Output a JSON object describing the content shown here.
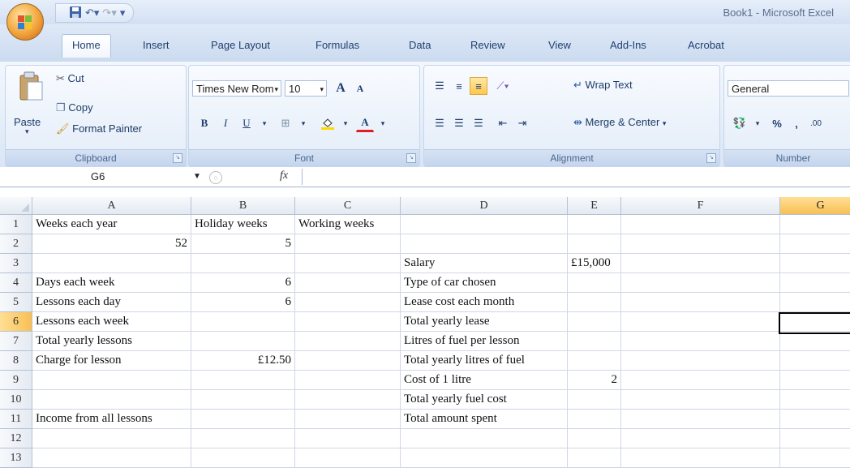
{
  "window": {
    "title": "Book1 - Microsoft Excel"
  },
  "qat": {
    "save_icon": "save-icon",
    "undo_icon": "undo-icon",
    "redo_icon": "redo-icon",
    "customize": "customize-arrow"
  },
  "tabs": [
    {
      "label": "Home",
      "active": true
    },
    {
      "label": "Insert"
    },
    {
      "label": "Page Layout"
    },
    {
      "label": "Formulas"
    },
    {
      "label": "Data"
    },
    {
      "label": "Review"
    },
    {
      "label": "View"
    },
    {
      "label": "Add-Ins"
    },
    {
      "label": "Acrobat"
    }
  ],
  "ribbon": {
    "clipboard": {
      "label": "Clipboard",
      "paste": "Paste",
      "cut": "Cut",
      "copy": "Copy",
      "format_painter": "Format Painter"
    },
    "font": {
      "label": "Font",
      "font_name": "Times New Rom",
      "font_size": "10",
      "bold": "B",
      "italic": "I",
      "underline": "U",
      "grow": "A",
      "shrink": "A",
      "font_color": "A"
    },
    "alignment": {
      "label": "Alignment",
      "wrap_text": "Wrap Text",
      "merge_center": "Merge & Center"
    },
    "number": {
      "label": "Number",
      "format": "General",
      "percent": "%",
      "comma": ","
    }
  },
  "formula_bar": {
    "name_box": "G6",
    "fx": "fx",
    "formula": ""
  },
  "columns": [
    "A",
    "B",
    "C",
    "D",
    "E",
    "F",
    "G"
  ],
  "selected_column": "G",
  "selected_row": "6",
  "rows": [
    {
      "num": "1",
      "A": "Weeks each year",
      "B": "Holiday weeks",
      "C": "Working weeks",
      "D": "",
      "E": ""
    },
    {
      "num": "2",
      "A": "52",
      "B": "5",
      "C": "",
      "D": "",
      "E": ""
    },
    {
      "num": "3",
      "A": "",
      "B": "",
      "C": "",
      "D": "Salary",
      "E": "£15,000"
    },
    {
      "num": "4",
      "A": "Days each week",
      "B": "6",
      "C": "",
      "D": "Type of car chosen",
      "E": ""
    },
    {
      "num": "5",
      "A": "Lessons each day",
      "B": "6",
      "C": "",
      "D": "Lease cost each month",
      "E": ""
    },
    {
      "num": "6",
      "A": "Lessons each week",
      "B": "",
      "C": "",
      "D": "Total yearly lease",
      "E": ""
    },
    {
      "num": "7",
      "A": "Total yearly lessons",
      "B": "",
      "C": "",
      "D": "Litres of fuel per lesson",
      "E": ""
    },
    {
      "num": "8",
      "A": "Charge for lesson",
      "B": "£12.50",
      "C": "",
      "D": "Total yearly litres of fuel",
      "E": ""
    },
    {
      "num": "9",
      "A": "",
      "B": "",
      "C": "",
      "D": "Cost of 1 litre",
      "E": "2"
    },
    {
      "num": "10",
      "A": "",
      "B": "",
      "C": "",
      "D": "Total yearly fuel cost",
      "E": ""
    },
    {
      "num": "11",
      "A": "Income from all lessons",
      "B": "",
      "C": "",
      "D": "Total amount spent",
      "E": ""
    },
    {
      "num": "12",
      "A": "",
      "B": "",
      "C": "",
      "D": "",
      "E": ""
    },
    {
      "num": "13",
      "A": "",
      "B": "",
      "C": "",
      "D": "",
      "E": ""
    }
  ],
  "numeric_cells": [
    "A2",
    "B2",
    "B4",
    "B5",
    "B8",
    "E9"
  ]
}
